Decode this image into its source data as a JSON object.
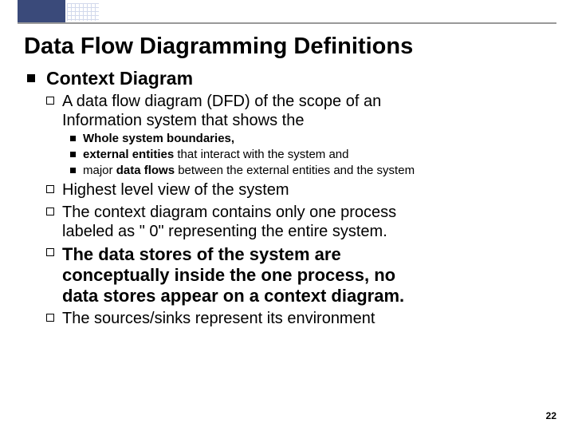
{
  "title": "Data Flow Diagramming Definitions",
  "subtitle": "Context Diagram",
  "b1": {
    "lead": "A",
    "text_a": " data flow diagram (DFD) of the scope of an",
    "text_b": "Information system that shows the"
  },
  "sub": {
    "s1": "Whole system boundaries,",
    "s2a": "external entities",
    "s2b": " that interact with the system and",
    "s3a": " major ",
    "s3b": "data flows",
    "s3c": " between the external entities and the system"
  },
  "b2": {
    "lead": "Highest",
    "rest": " level view of the system"
  },
  "b3": {
    "lead": "The",
    "rest_a": " context diagram contains only one process",
    "rest_b": "labeled as \" 0\" representing the entire system."
  },
  "b4": {
    "lead": "The",
    "rest_a": " data stores of the system are",
    "rest_b": "conceptually inside the one process, no",
    "rest_c": "data stores appear on a context diagram."
  },
  "b5": {
    "lead": "The",
    "rest": " sources/sinks represent its environment"
  },
  "page": "22"
}
